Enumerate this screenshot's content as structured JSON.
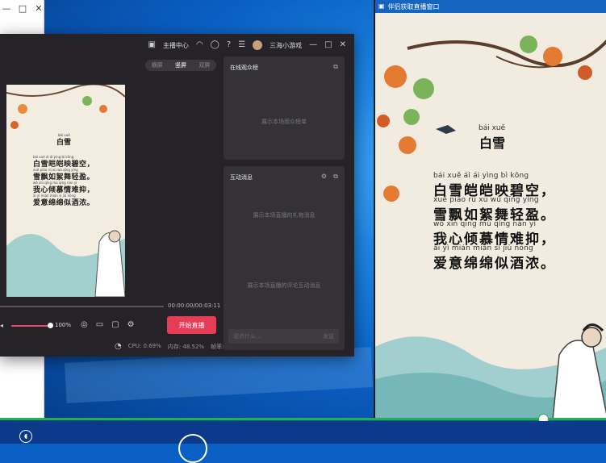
{
  "left_window": {
    "controls": [
      "—",
      "□",
      "✕"
    ]
  },
  "app": {
    "titlebar": {
      "anchor_center": "主播中心",
      "username": "三海小游戏",
      "window_controls": [
        "—",
        "□",
        "✕"
      ]
    },
    "mode_tabs": [
      "横屏",
      "竖屏",
      "双屏"
    ],
    "time": "00:00:00/00:03:11",
    "volume": "100%",
    "start_live": "开始直播",
    "stats": {
      "cpu": "CPU: 0.69%",
      "memory": "内存: 48.52%",
      "fps": "帧率:30"
    },
    "audience_panel": {
      "title": "在线观众榜",
      "hint": "展示本场观众榜单"
    },
    "interaction_panel": {
      "title": "互动消息",
      "gift_hint": "展示本场直播的礼物消息",
      "comment_hint": "展示本场直播的评论互动消息",
      "input_placeholder": "说点什么...",
      "send": "发送"
    },
    "preview": {
      "title_py": "bái xuě",
      "title": "白雪",
      "lines": [
        {
          "py": "bái xuě ái ái yìng bì kōng",
          "text": "白雪皑皑映碧空，"
        },
        {
          "py": "xuě piāo rú xù wǔ qīng yíng",
          "text": "雪飘如絮舞轻盈。"
        },
        {
          "py": "wǒ xīn qīng mù qíng nán yì",
          "text": "我心倾慕情难抑，"
        },
        {
          "py": "ài yì mián mián sì jiǔ nóng",
          "text": "爱意绵绵似酒浓。"
        }
      ]
    }
  },
  "projection": {
    "title": "伴侣获取直播窗口",
    "poem": {
      "title_py": "bái xuě",
      "title": "白雪",
      "lines": [
        {
          "py": "bái xuě ái ái yìng bì kōng",
          "text": "白雪皑皑映碧空，"
        },
        {
          "py": "xuě piāo rú xù wǔ qīng yíng",
          "text": "雪飘如絮舞轻盈。"
        },
        {
          "py": "wǒ xīn qīng mù qíng nán yì",
          "text": "我心倾慕情难抑，"
        },
        {
          "py": "ài yì mián mián sì jiǔ nóng",
          "text": "爱意绵绵似酒浓。"
        }
      ]
    }
  },
  "colors": {
    "live_button": "#e63c56",
    "app_bg": "#252327",
    "progress_green": "#22b14c",
    "titlebar_blue": "#1565c0"
  }
}
